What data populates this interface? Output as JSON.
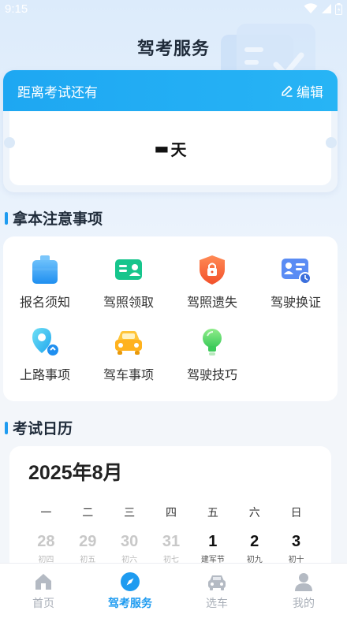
{
  "status": {
    "time": "9:15"
  },
  "header": {
    "title": "驾考服务"
  },
  "countdown": {
    "label": "距离考试还有",
    "edit_label": "编辑",
    "value": "▬",
    "unit": "天"
  },
  "notice_section": {
    "title": "拿本注意事项",
    "items": [
      {
        "label": "报名须知",
        "icon": "clipboard-icon"
      },
      {
        "label": "驾照领取",
        "icon": "license-card-icon"
      },
      {
        "label": "驾照遗失",
        "icon": "shield-lock-icon"
      },
      {
        "label": "驾驶换证",
        "icon": "id-card-clock-icon"
      },
      {
        "label": "上路事项",
        "icon": "map-pin-icon"
      },
      {
        "label": "驾车事项",
        "icon": "car-icon"
      },
      {
        "label": "驾驶技巧",
        "icon": "lightbulb-icon"
      }
    ]
  },
  "calendar_section": {
    "title": "考试日历",
    "month": "2025年8月",
    "weekdays": [
      "一",
      "二",
      "三",
      "四",
      "五",
      "六",
      "日"
    ],
    "dates": [
      {
        "day": "28",
        "lunar": "初四",
        "current": false
      },
      {
        "day": "29",
        "lunar": "初五",
        "current": false
      },
      {
        "day": "30",
        "lunar": "初六",
        "current": false
      },
      {
        "day": "31",
        "lunar": "初七",
        "current": false
      },
      {
        "day": "1",
        "lunar": "建军节",
        "current": true
      },
      {
        "day": "2",
        "lunar": "初九",
        "current": true
      },
      {
        "day": "3",
        "lunar": "初十",
        "current": true
      }
    ]
  },
  "bottom_nav": {
    "items": [
      {
        "label": "首页",
        "icon": "home-icon",
        "active": false
      },
      {
        "label": "驾考服务",
        "icon": "compass-icon",
        "active": true
      },
      {
        "label": "选车",
        "icon": "car-icon",
        "active": false
      },
      {
        "label": "我的",
        "icon": "user-icon",
        "active": false
      }
    ]
  },
  "colors": {
    "accent": "#1e9bf0",
    "inactive": "#a9afb8"
  }
}
